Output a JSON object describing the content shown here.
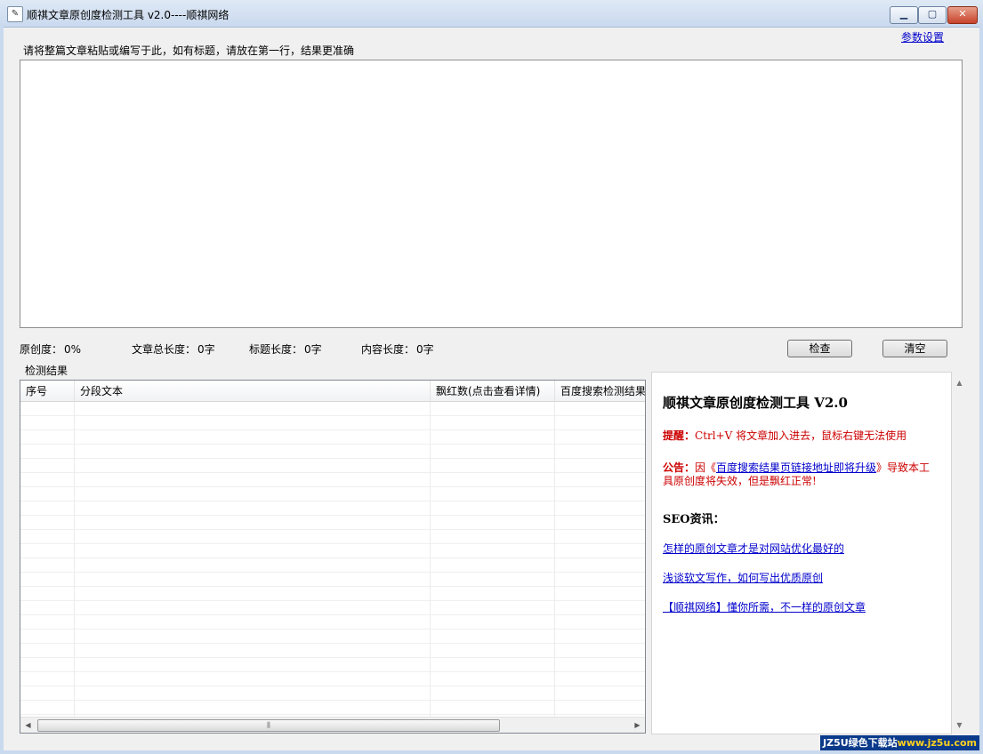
{
  "window": {
    "title": "顺祺文章原创度检测工具  v2.0----顺祺网络",
    "icon": "app-icon"
  },
  "settings_link": "参数设置",
  "input": {
    "hint": "请将整篇文章粘贴或编写于此，如有标题，请放在第一行，结果更准确",
    "value": ""
  },
  "stats": {
    "originality": {
      "label": "原创度：",
      "value": "0%"
    },
    "total_length": {
      "label": "文章总长度：",
      "value": "0字"
    },
    "title_length": {
      "label": "标题长度：",
      "value": "0字"
    },
    "content_length": {
      "label": "内容长度：",
      "value": "0字"
    }
  },
  "buttons": {
    "check": "检查",
    "clear": "清空"
  },
  "results": {
    "label": "检测结果",
    "columns": [
      "序号",
      "分段文本",
      "飘红数(点击查看详情)",
      "百度搜索检测结果"
    ],
    "rows": []
  },
  "info": {
    "title": "顺祺文章原创度检测工具 V2.0",
    "tip_label": "提醒：",
    "tip_text": "Ctrl+V 将文章加入进去，鼠标右键无法使用",
    "notice_label": "公告：",
    "notice_pre": "因《",
    "notice_link": "百度搜索结果页链接地址即将升级",
    "notice_post": "》导致本工具原创度将失效，但是飘红正常!",
    "seo_heading": "SEO资讯：",
    "news": [
      "怎样的原创文章才是对网站优化最好的",
      "浅谈软文写作，如何写出优质原创",
      "【顺祺网络】懂你所需，不一样的原创文章"
    ]
  },
  "watermark": {
    "brand": "JZ5U绿色下载站",
    "url": "www.jz5u.com"
  }
}
